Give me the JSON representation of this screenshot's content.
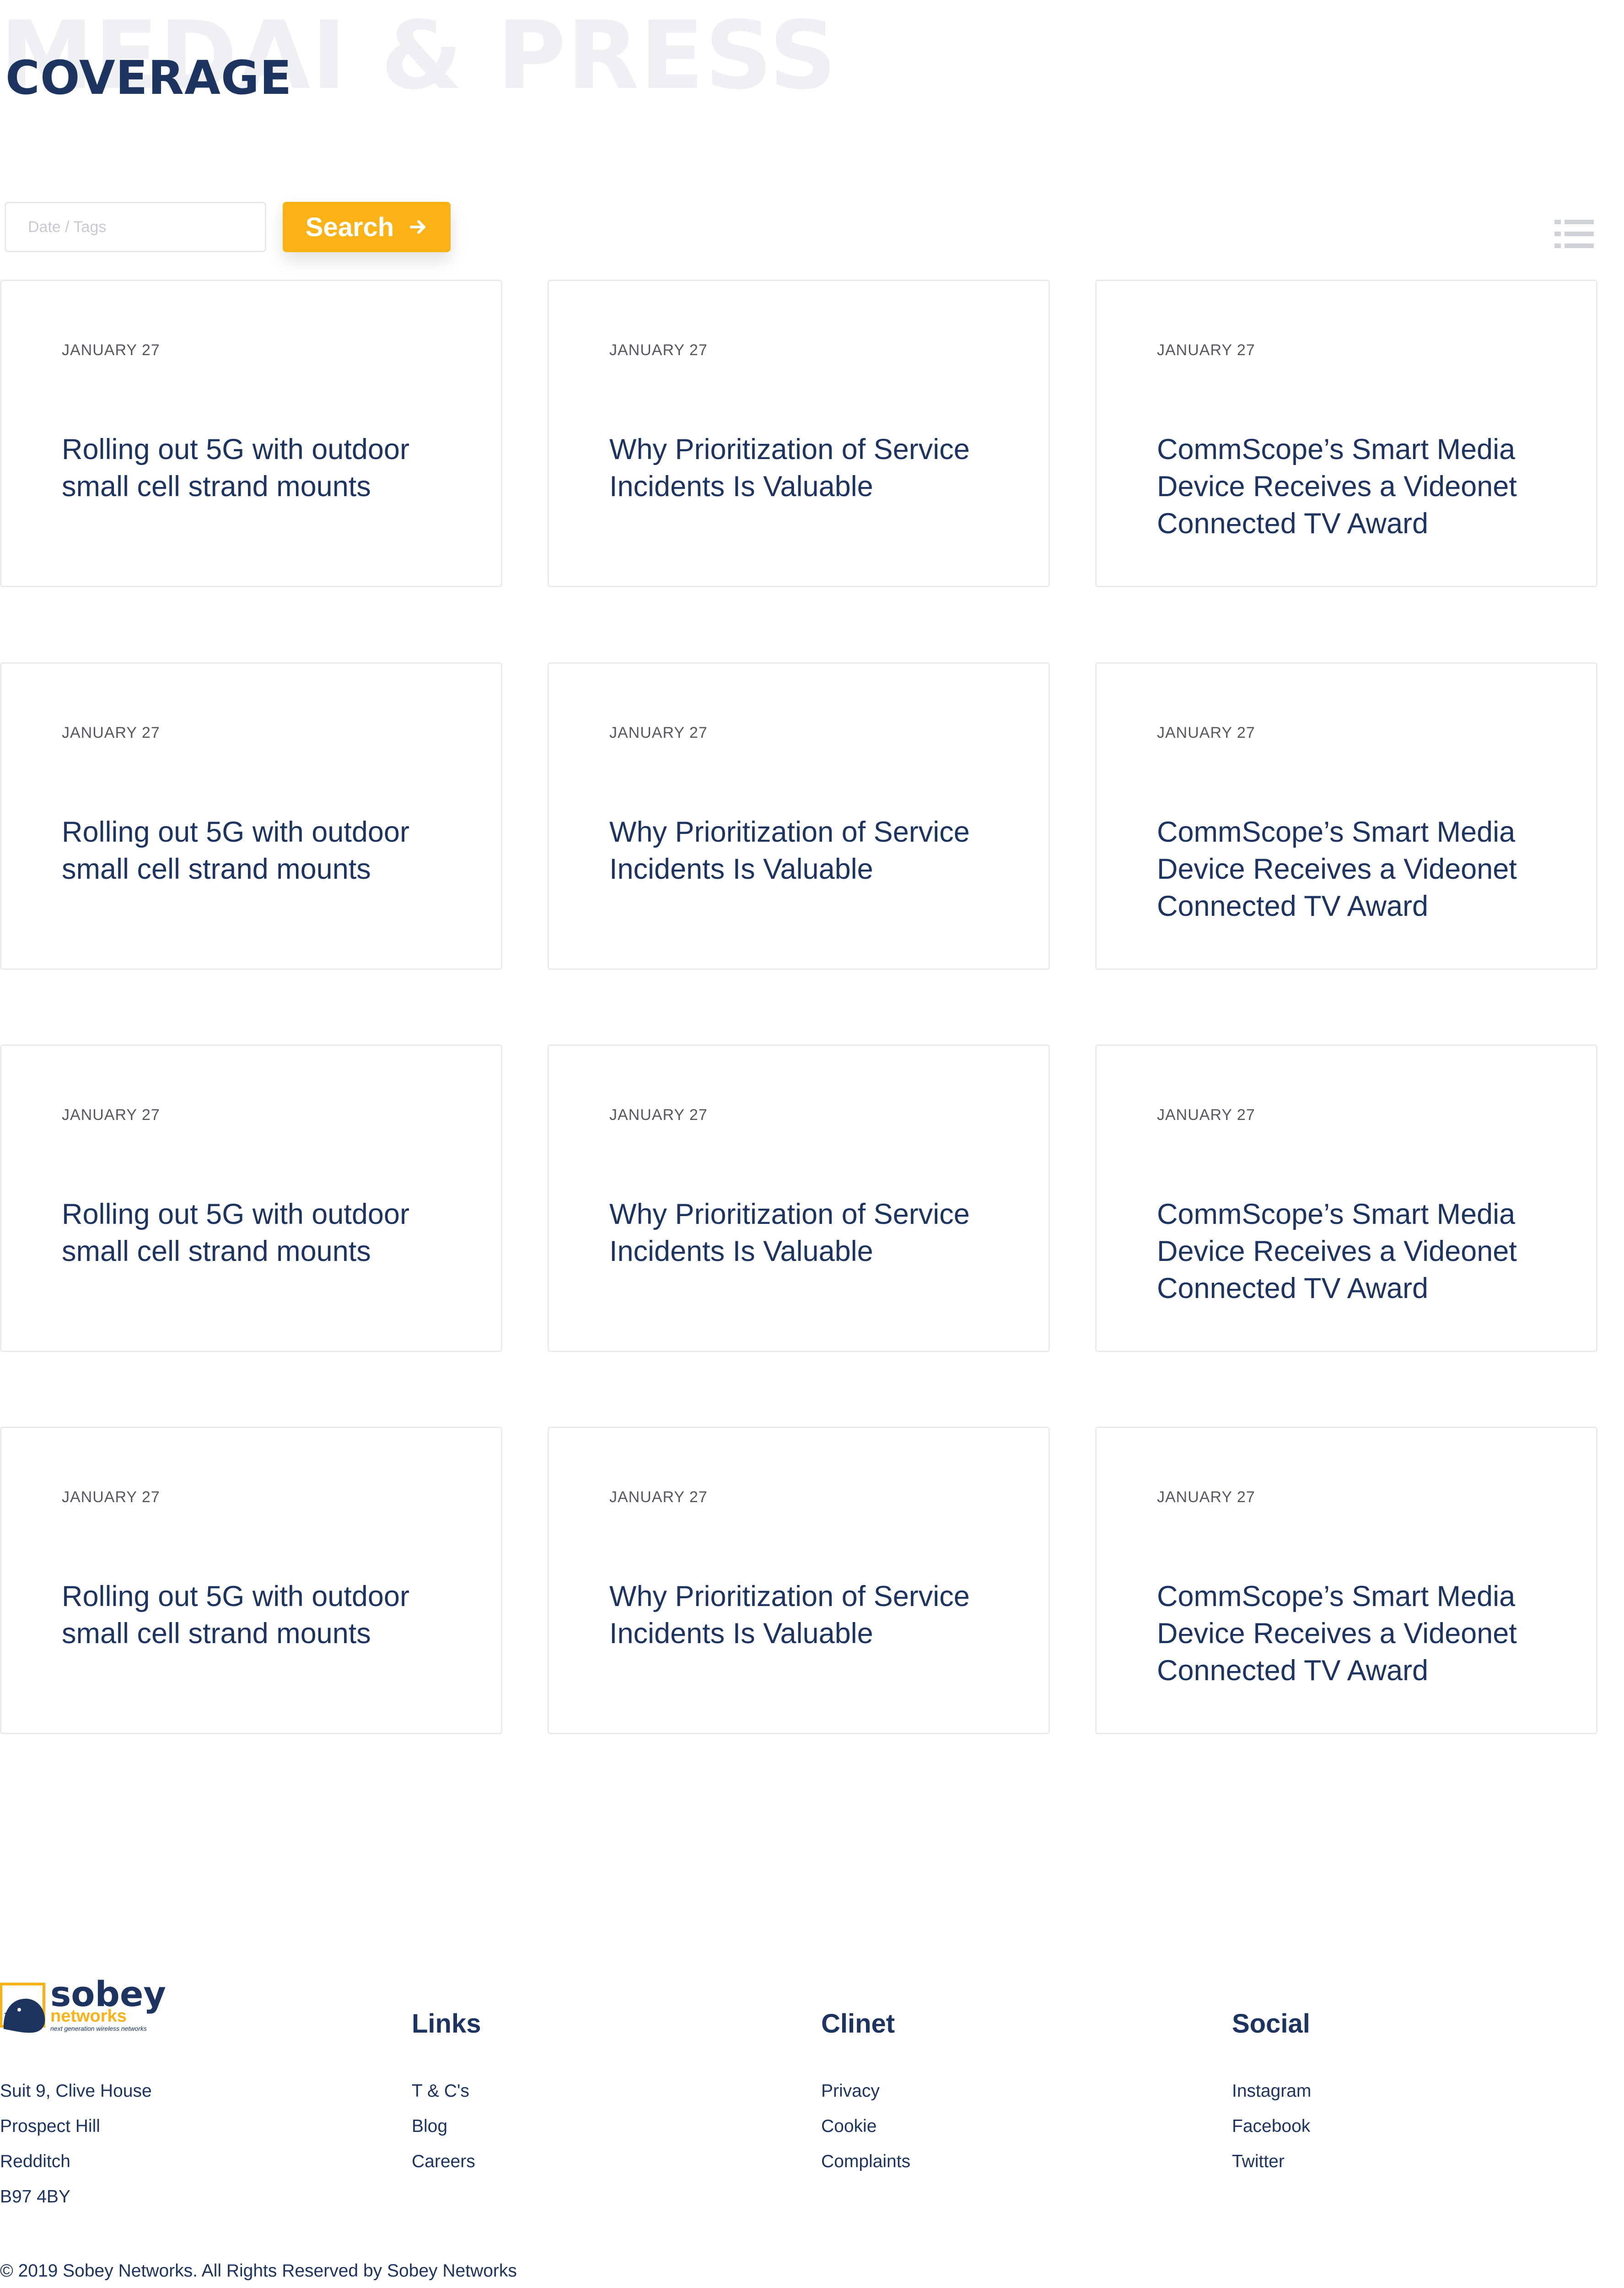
{
  "header": {
    "background_title": "MEDAI & PRESS",
    "title": "COVERAGE"
  },
  "search": {
    "placeholder": "Date / Tags",
    "button_label": "Search",
    "button_icon": "arrow-right-icon",
    "view_toggle_icon": "list-view-icon"
  },
  "colors": {
    "brand_navy": "#1d3461",
    "accent_yellow": "#fbb216"
  },
  "articles": [
    {
      "date": "JANUARY 27",
      "title": "Rolling out 5G with outdoor small cell strand mounts"
    },
    {
      "date": "JANUARY 27",
      "title": "Why Prioritization of Service Incidents Is Valuable"
    },
    {
      "date": "JANUARY 27",
      "title": "CommScope’s Smart Media Device Receives a Videonet Connected TV Award"
    },
    {
      "date": "JANUARY 27",
      "title": "Rolling out 5G with outdoor small cell strand mounts"
    },
    {
      "date": "JANUARY 27",
      "title": "Why Prioritization of Service Incidents Is Valuable"
    },
    {
      "date": "JANUARY 27",
      "title": "CommScope’s Smart Media Device Receives a Videonet Connected TV Award"
    },
    {
      "date": "JANUARY 27",
      "title": "Rolling out 5G with outdoor small cell strand mounts"
    },
    {
      "date": "JANUARY 27",
      "title": "Why Prioritization of Service Incidents Is Valuable"
    },
    {
      "date": "JANUARY 27",
      "title": "CommScope’s Smart Media Device Receives a Videonet Connected TV Award"
    },
    {
      "date": "JANUARY 27",
      "title": "Rolling out 5G with outdoor small cell strand mounts"
    },
    {
      "date": "JANUARY 27",
      "title": "Why Prioritization of Service Incidents Is Valuable"
    },
    {
      "date": "JANUARY 27",
      "title": "CommScope’s Smart Media Device Receives a Videonet Connected TV Award"
    }
  ],
  "footer": {
    "logo": {
      "name": "sobey",
      "sub": "networks",
      "tagline": "next generation wireless networks"
    },
    "address": [
      "Suit 9, Clive House",
      "Prospect Hill",
      "Redditch",
      "B97 4BY"
    ],
    "columns": [
      {
        "heading": "Links",
        "items": [
          "T & C's",
          "Blog",
          "Careers"
        ]
      },
      {
        "heading": "Clinet",
        "items": [
          "Privacy",
          "Cookie",
          "Complaints"
        ]
      },
      {
        "heading": "Social",
        "items": [
          "Instagram",
          "Facebook",
          "Twitter"
        ]
      }
    ],
    "copyright": "© 2019 Sobey Networks. All Rights Reserved by Sobey Networks"
  }
}
